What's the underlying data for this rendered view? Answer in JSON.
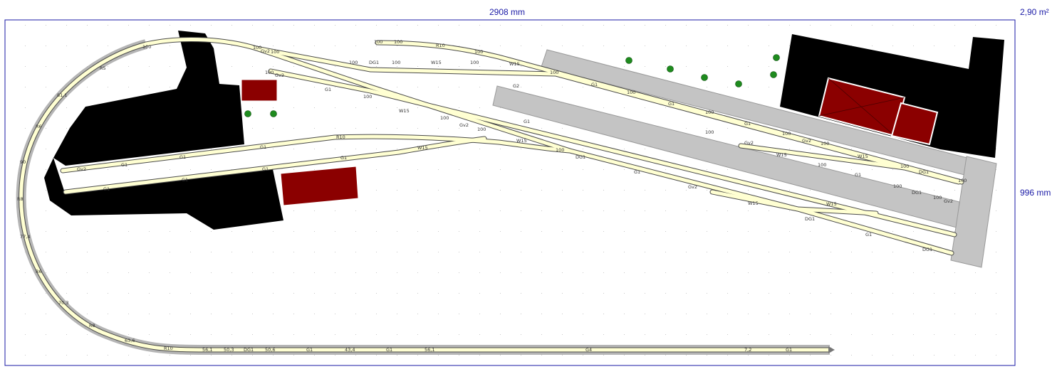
{
  "dimensions": {
    "width": "2908 mm",
    "depth": "996 mm",
    "area": "2,90 m²"
  },
  "colors": {
    "background": "#ffffff",
    "frame": "#1a1aa6",
    "grid_dot": "#c8c8c8",
    "track_bed": "#b5b5b5",
    "track_fill": "#ffffd2",
    "track_edge": "#4a4a4a",
    "terrain": "#000000",
    "platform": "#c4c4c4",
    "building": "#8b0000",
    "tree": "#1e8b1e"
  },
  "track_labels": {
    "curve_r5": "R5",
    "curve_r6": "R6",
    "curve_r8": "R8",
    "curve_r10": "R10",
    "curve_r6_lower": "R6",
    "curve_r8_lower": "R8",
    "s100_a": "100",
    "s100_b": "100",
    "s100_c": "100",
    "s100_d": "100",
    "s100_e": "100",
    "s100_f": "100",
    "s100_g": "100",
    "s100_h": "100",
    "s100_i": "100",
    "s100_j": "100",
    "s100_k": "100",
    "s100_l": "100",
    "s100_m": "100",
    "s100_n": "100",
    "s100_o": "100",
    "s100_p": "100",
    "s100_q": "100",
    "s100_r": "100",
    "s100_s": "100",
    "s100_t": "100",
    "s100_u": "100",
    "s100_v": "100",
    "s100_w": "100",
    "s100_x": "100",
    "s100_y": "100",
    "g1_a": "G1",
    "g1_b": "G1",
    "g1_c": "G1",
    "g1_d": "G1",
    "g1_e": "G1",
    "g1_f": "G1",
    "g1_g": "G1",
    "g1_h": "G1",
    "g1_i": "G1",
    "g1_j": "G1",
    "g1_k": "G1",
    "g1_l": "G1",
    "g1_m": "G1",
    "g1_n": "G1",
    "g1_o": "G1",
    "g2_a": "G2",
    "g2_b": "G2",
    "g2_c": "G2",
    "g4": "G4",
    "gv2_a": "Gv2",
    "gv2_b": "Gv2",
    "gv2_c": "Gv2",
    "gv2_d": "Gv2",
    "gv2_e": "Gv2",
    "gv2_f": "Gv2",
    "dg1_a": "DG1",
    "dg1_b": "DG1",
    "dg1_c": "DG1",
    "dg1_d": "DG1",
    "dg1_e": "DG1",
    "dg1_f": "DG1",
    "dg1_g": "DG1",
    "w15_a": "W15",
    "w15_b": "W15",
    "w15_c": "W15",
    "w15_d": "W15",
    "w15_e": "W15",
    "w15_f": "W15",
    "w15_g": "W15",
    "w15_h": "W15",
    "bw_1": "50,6",
    "bw_2": "56,1",
    "bw_3": "50,3",
    "bw_4": "43,4",
    "bw_5": "56,1",
    "bw_6": "7,2",
    "bw_7": "63,6",
    "bw_8": "70,3",
    "bw_9": "77,4",
    "bw_10": "81,1",
    "bw_11": "90",
    "bw_12": "R10",
    "bw_13": "Gv2"
  }
}
